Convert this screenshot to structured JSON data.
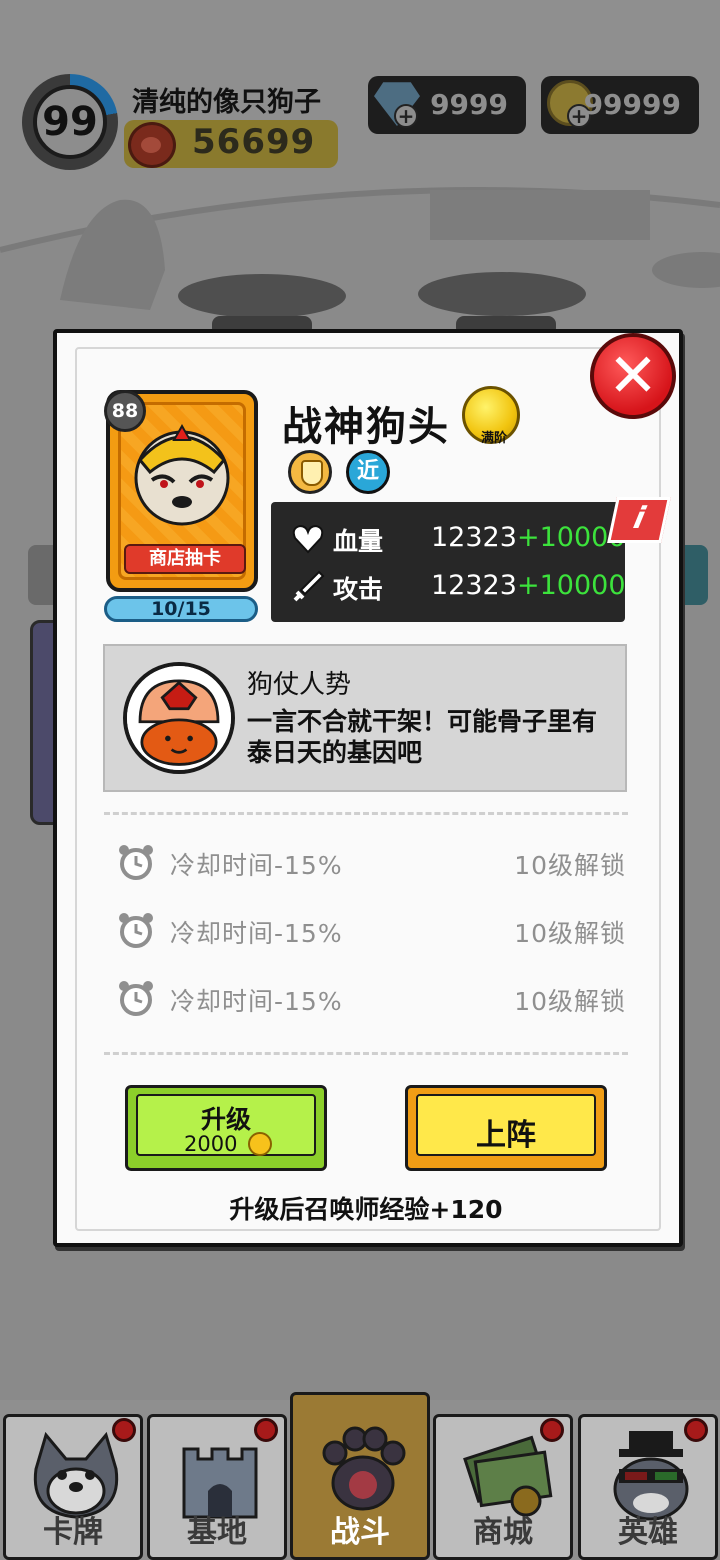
{
  "player": {
    "level": "99",
    "name": "清纯的像只狗子",
    "power": "56699"
  },
  "currencies": {
    "gems": "9999",
    "coins": "99999",
    "gem_icon": "diamond-icon",
    "coin_icon": "coin-icon"
  },
  "hero": {
    "name": "战神狗头",
    "level": "88",
    "card_tag": "商店抽卡",
    "shards": "10/15",
    "star_badge_label": "满阶",
    "type_badge": "近",
    "stats": [
      {
        "name": "血量",
        "base": "12323",
        "bonus": "+10000",
        "icon": "heart-icon"
      },
      {
        "name": "攻击",
        "base": "12323",
        "bonus": "+10000",
        "icon": "sword-icon"
      }
    ]
  },
  "skill": {
    "title": "狗仗人势",
    "description": "一言不合就干架！可能骨子里有泰日天的基因吧"
  },
  "perks": [
    {
      "text": "冷却时间-15%",
      "unlock": "10级解锁"
    },
    {
      "text": "冷却时间-15%",
      "unlock": "10级解锁"
    },
    {
      "text": "冷却时间-15%",
      "unlock": "10级解锁"
    }
  ],
  "actions": {
    "upgrade_label": "升级",
    "upgrade_cost": "2000",
    "deploy_label": "上阵",
    "exp_note": "升级后召唤师经验+120"
  },
  "nav": [
    {
      "label": "卡牌",
      "icon": "dog-face-icon",
      "badge": true
    },
    {
      "label": "基地",
      "icon": "castle-icon",
      "badge": true
    },
    {
      "label": "战斗",
      "icon": "paw-icon",
      "badge": false,
      "active": true
    },
    {
      "label": "商城",
      "icon": "money-icon",
      "badge": true
    },
    {
      "label": "英雄",
      "icon": "hero-face-icon",
      "badge": true
    }
  ],
  "colors": {
    "stat_bonus": "#3ce23c",
    "upgrade_button": "#b5f14a",
    "deploy_button": "#ffe84a",
    "close_button": "#d6141a"
  }
}
